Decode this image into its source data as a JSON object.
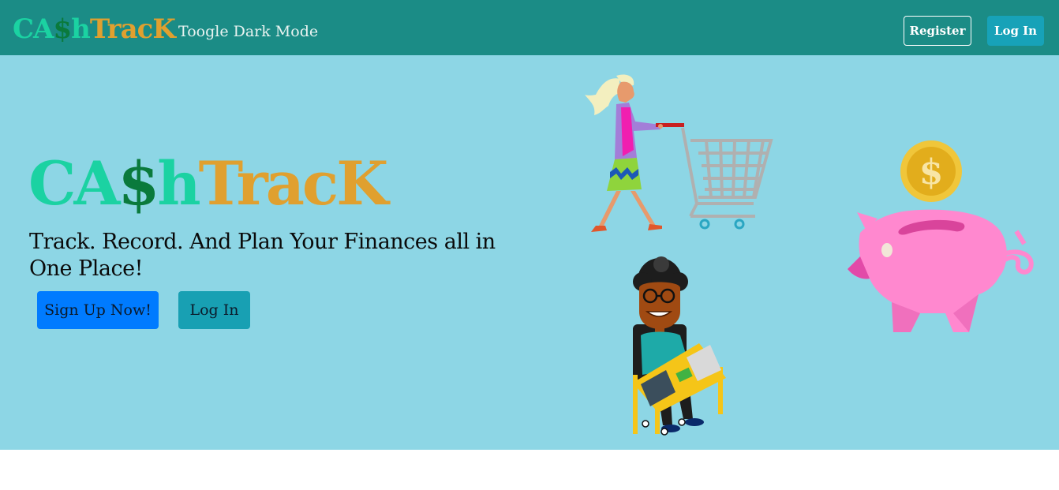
{
  "navbar": {
    "brand": {
      "part1": "CA",
      "part2": "$",
      "part3": "h",
      "part4": "TracK"
    },
    "toggle_label": "Toogle Dark Mode",
    "register_label": "Register",
    "login_label": "Log In"
  },
  "hero": {
    "brand": {
      "part1": "CA",
      "part2": "$",
      "part3": "h",
      "part4": "TracK"
    },
    "tagline": "Track. Record. And Plan Your Finances all in One Place!",
    "signup_label": "Sign Up Now!",
    "login_label": "Log In"
  },
  "colors": {
    "navbar_bg": "#1b8c86",
    "hero_bg": "#8dd6e5",
    "brand_teal": "#1bd2a2",
    "brand_green": "#0a7a3c",
    "brand_gold": "#e0a02f",
    "primary_button": "#007bff",
    "info_button": "#17a2b8"
  },
  "icons": [
    "shopping-woman-illustration",
    "piggy-bank-illustration",
    "person-with-laptop-illustration"
  ]
}
